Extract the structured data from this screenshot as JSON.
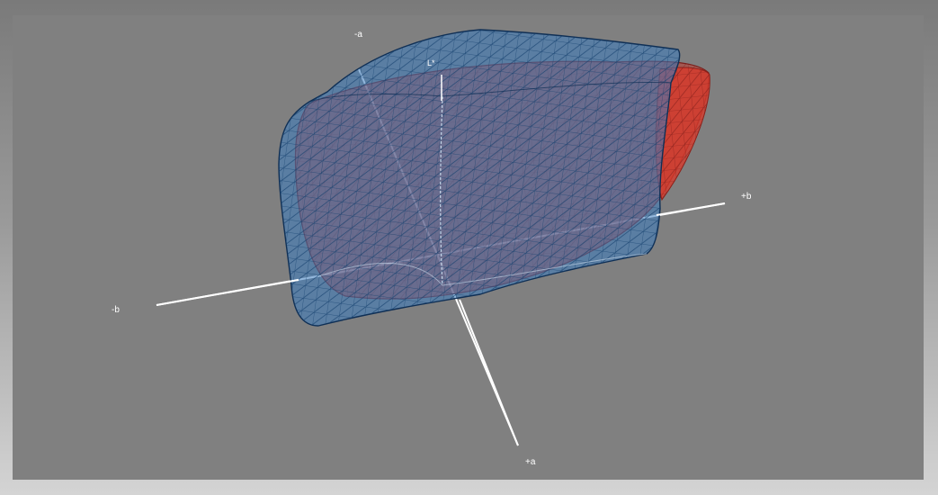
{
  "viewer": {
    "axes": {
      "minus_a": "-a",
      "plus_a": "+a",
      "minus_b": "-b",
      "plus_b": "+b",
      "l_star": "L*"
    },
    "gamuts": [
      {
        "color": "#1f5fa8",
        "fill": "#3a7bc0"
      },
      {
        "color": "#c0392b",
        "fill": "#d35442"
      }
    ],
    "axis_color": "#ffffff",
    "background": "#808080"
  }
}
